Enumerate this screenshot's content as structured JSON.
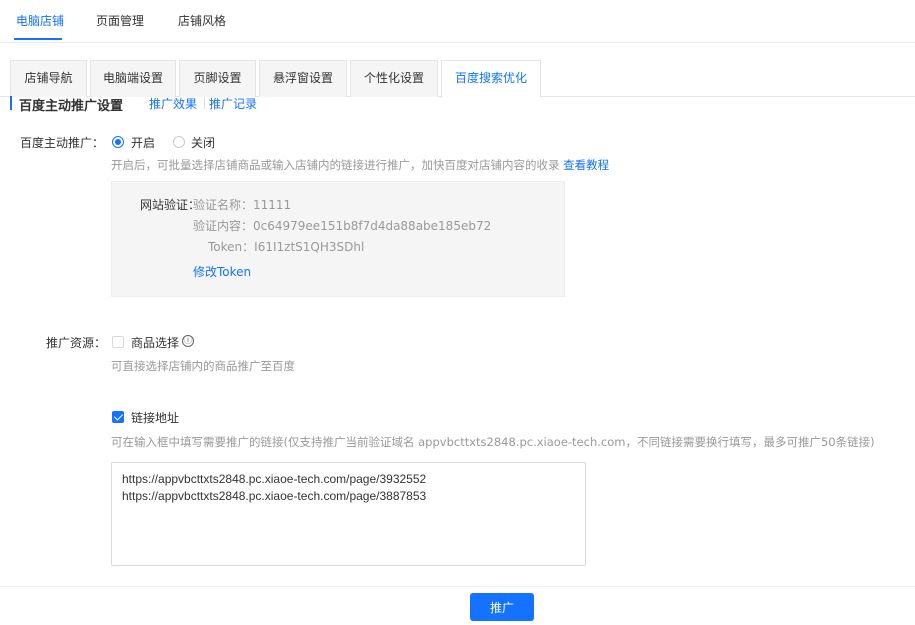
{
  "top_nav": {
    "items": [
      {
        "label": "电脑店铺"
      },
      {
        "label": "页面管理"
      },
      {
        "label": "店铺风格"
      }
    ]
  },
  "tabs": [
    {
      "label": "店铺导航"
    },
    {
      "label": "电脑端设置"
    },
    {
      "label": "页脚设置"
    },
    {
      "label": "悬浮窗设置"
    },
    {
      "label": "个性化设置"
    },
    {
      "label": "百度搜索优化"
    }
  ],
  "section": {
    "title": "百度主动推广设置",
    "links": [
      "推广效果",
      "推广记录"
    ]
  },
  "push": {
    "label": "百度主动推广：",
    "options": [
      {
        "label": "开启",
        "checked": true
      },
      {
        "label": "关闭",
        "checked": false
      }
    ],
    "hint": "开启后，可批量选择店铺商品或输入店铺内的链接进行推广，加快百度对店铺内容的收录",
    "hint_link": "查看教程"
  },
  "verify": {
    "label": "网站验证：",
    "name_label": "验证名称：",
    "name_value": "11111",
    "content_label": "验证内容：",
    "content_value": "0c64979ee151b8f7d4da88abe185eb72",
    "token_label": "Token：",
    "token_value": "I61I1ztS1QH3SDhl",
    "edit_link": "修改Token"
  },
  "resource": {
    "label": "推广资源：",
    "product_option": {
      "label": "商品选择",
      "checked": false
    },
    "info_icon": "ⓘ",
    "product_hint": "可直接选择店铺内的商品推广至百度",
    "link_option": {
      "label": "链接地址",
      "checked": true
    },
    "link_hint": "可在输入框中填写需要推广的链接(仅支持推广当前验证域名 appvbcttxts2848.pc.xiaoe-tech.com，不同链接需要换行填写，最多可推广50条链接)",
    "links_value": "https://appvbcttxts2848.pc.xiaoe-tech.com/page/3932552\nhttps://appvbcttxts2848.pc.xiaoe-tech.com/page/3887853"
  },
  "footer": {
    "submit_label": "推广"
  },
  "colors": {
    "accent": "#1472ff",
    "muted_text": "#999999",
    "panel_bg": "#f5f5f5"
  }
}
